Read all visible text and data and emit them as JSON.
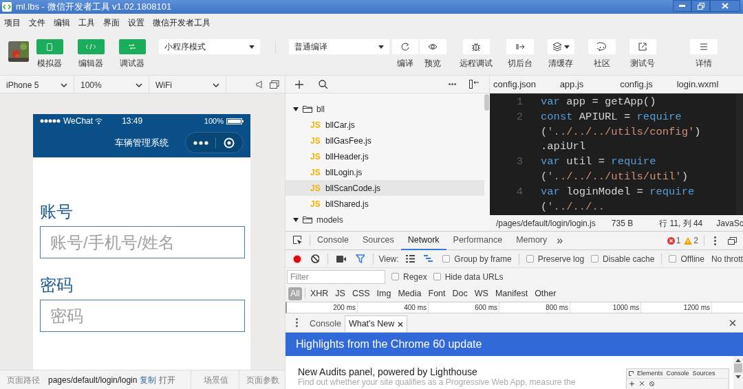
{
  "window": {
    "title": "ml.lbs - 微信开发者工具 v1.02.1808101"
  },
  "menu": [
    "项目",
    "文件",
    "编辑",
    "工具",
    "界面",
    "设置",
    "微信开发者工具"
  ],
  "view_buttons": [
    {
      "label": "模拟器"
    },
    {
      "label": "编辑器"
    },
    {
      "label": "调试器"
    }
  ],
  "mode_select": {
    "value": "小程序模式"
  },
  "compile_select": {
    "value": "普通编译"
  },
  "tools": [
    {
      "label": "编译"
    },
    {
      "label": "预览"
    },
    {
      "label": "远程调试"
    },
    {
      "label": "切后台"
    },
    {
      "label": "清缓存"
    },
    {
      "label": "社区"
    },
    {
      "label": "测试号"
    },
    {
      "label": "详情"
    }
  ],
  "device_bar": {
    "device": "iPhone 5",
    "zoom": "100%",
    "network": "WiFi"
  },
  "phone": {
    "carrier": "WeChat",
    "time": "13:49",
    "battery": "100%",
    "nav_title": "车辆管理系统",
    "fields": [
      {
        "label": "账号",
        "placeholder": "账号/手机号/姓名"
      },
      {
        "label": "密码",
        "placeholder": "密码"
      }
    ]
  },
  "simulator_footer": {
    "path_label": "页面路径",
    "path": "pages/default/login/login",
    "copy": "复制",
    "open": "打开",
    "scene": "场景值",
    "params": "页面参数"
  },
  "file_tree": [
    {
      "kind": "folder",
      "name": "bll",
      "expanded": true,
      "children": [
        {
          "kind": "file",
          "type_label": "JS",
          "name": "bllCar.js",
          "selected": false
        },
        {
          "kind": "file",
          "type_label": "JS",
          "name": "bllGasFee.js",
          "selected": false
        },
        {
          "kind": "file",
          "type_label": "JS",
          "name": "bllHeader.js",
          "selected": false
        },
        {
          "kind": "file",
          "type_label": "JS",
          "name": "bllLogin.js",
          "selected": false
        },
        {
          "kind": "file",
          "type_label": "JS",
          "name": "bllScanCode.js",
          "selected": true
        },
        {
          "kind": "file",
          "type_label": "JS",
          "name": "bllShared.js",
          "selected": false
        }
      ]
    },
    {
      "kind": "folder",
      "name": "models",
      "expanded": true
    }
  ],
  "editor_tabs": [
    "config.json",
    "app.js",
    "config.js",
    "login.wxml"
  ],
  "code_rows": [
    {
      "number": "1",
      "tokens": [
        {
          "kind": "keyword",
          "text": "var"
        },
        {
          "kind": "plain",
          "text": " app = getApp()"
        }
      ]
    },
    {
      "number": "2",
      "tokens": [
        {
          "kind": "keyword",
          "text": "const"
        },
        {
          "kind": "plain",
          "text": " APIURL = "
        },
        {
          "kind": "keyword",
          "text": "require"
        }
      ]
    },
    {
      "tokens": [
        {
          "kind": "plain",
          "text": "("
        },
        {
          "kind": "string",
          "text": "'../../../utils/config'"
        },
        {
          "kind": "plain",
          "text": ")"
        }
      ]
    },
    {
      "tokens": [
        {
          "kind": "plain",
          "text": ".apiUrl"
        }
      ]
    },
    {
      "number": "3",
      "tokens": [
        {
          "kind": "keyword",
          "text": "var"
        },
        {
          "kind": "plain",
          "text": " util = "
        },
        {
          "kind": "keyword",
          "text": "require"
        }
      ]
    },
    {
      "tokens": [
        {
          "kind": "plain",
          "text": "("
        },
        {
          "kind": "string",
          "text": "'../../../utils/util'"
        },
        {
          "kind": "plain",
          "text": ")"
        }
      ]
    },
    {
      "number": "4",
      "tokens": [
        {
          "kind": "keyword",
          "text": "var"
        },
        {
          "kind": "plain",
          "text": " loginModel = "
        },
        {
          "kind": "keyword",
          "text": "require"
        }
      ]
    },
    {
      "tokens": [
        {
          "kind": "plain",
          "text": "("
        },
        {
          "kind": "string",
          "text": "'../../.."
        }
      ]
    }
  ],
  "editor_status": {
    "file": "/pages/default/login/login.js",
    "size": "735 B",
    "position": "行 11, 列 44",
    "language": "JavaSc"
  },
  "devtools": {
    "tabs": [
      {
        "label": "Console",
        "selected": false
      },
      {
        "label": "Sources",
        "selected": false
      },
      {
        "label": "Network",
        "selected": true
      },
      {
        "label": "Performance",
        "selected": false
      },
      {
        "label": "Memory",
        "selected": false
      }
    ],
    "more": "»",
    "errors": "1",
    "warnings": "2",
    "view_label": "View:",
    "options": [
      {
        "label": "Group by frame",
        "checked": false
      },
      {
        "label": "Preserve log",
        "checked": false
      },
      {
        "label": "Disable cache",
        "checked": false
      },
      {
        "label": "Offline",
        "checked": false
      }
    ],
    "throttle": "No thrott",
    "filter": {
      "placeholder": "Filter"
    },
    "filter_options": [
      {
        "label": "Regex",
        "checked": false
      },
      {
        "label": "Hide data URLs",
        "checked": false
      }
    ],
    "types": [
      {
        "label": "All",
        "selected": true
      },
      {
        "label": "XHR",
        "selected": false
      },
      {
        "label": "JS",
        "selected": false
      },
      {
        "label": "CSS",
        "selected": false
      },
      {
        "label": "Img",
        "selected": false
      },
      {
        "label": "Media",
        "selected": false
      },
      {
        "label": "Font",
        "selected": false
      },
      {
        "label": "Doc",
        "selected": false
      },
      {
        "label": "WS",
        "selected": false
      },
      {
        "label": "Manifest",
        "selected": false
      },
      {
        "label": "Other",
        "selected": false
      }
    ],
    "timeline_ticks": [
      "200 ms",
      "400 ms",
      "600 ms",
      "800 ms",
      "1000 ms",
      "1200 ms"
    ],
    "drawer_tabs": [
      {
        "label": "Console",
        "selected": false,
        "closable": false
      },
      {
        "label": "What's New",
        "selected": true,
        "closable": true
      }
    ],
    "banner": "Highlights from the Chrome 60 update",
    "article_title": "New Audits panel, powered by Lighthouse",
    "article_text": "Find out whether your site qualifies as a Progressive Web App, measure the",
    "inset_tabs": [
      "Elements",
      "Console",
      "Sources"
    ]
  }
}
